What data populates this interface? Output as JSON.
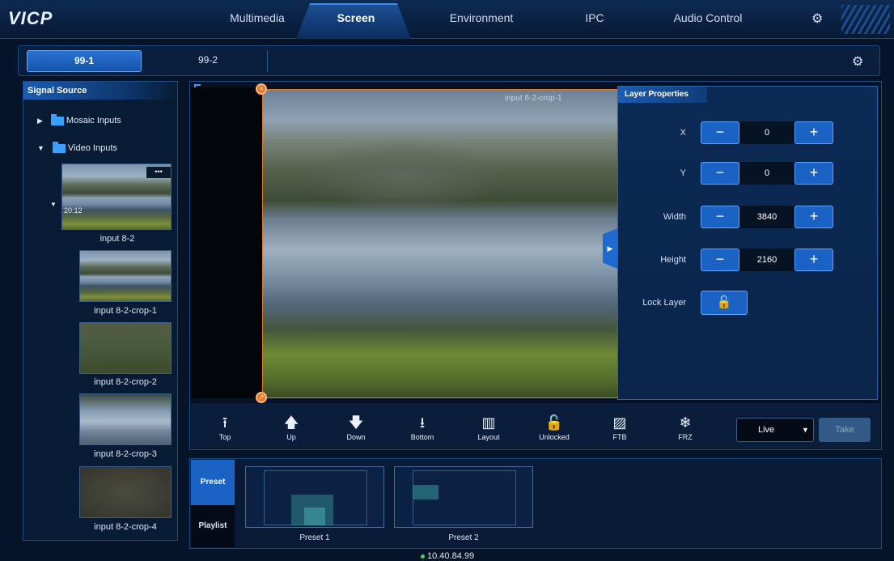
{
  "app": {
    "logo": "VICP"
  },
  "nav": {
    "tabs": [
      {
        "label": "Multimedia",
        "active": false
      },
      {
        "label": "Screen",
        "active": true
      },
      {
        "label": "Environment",
        "active": false
      },
      {
        "label": "IPC",
        "active": false
      },
      {
        "label": "Audio Control",
        "active": false
      }
    ],
    "settings_icon": "gear-icon"
  },
  "screens": {
    "tabs": [
      {
        "label": "99-1",
        "active": true
      },
      {
        "label": "99-2",
        "active": false
      }
    ],
    "settings_icon": "gear-icon"
  },
  "signal_source": {
    "title": "Signal Source",
    "groups": [
      {
        "label": "Mosaic Inputs",
        "expanded": false
      },
      {
        "label": "Video Inputs",
        "expanded": true
      }
    ],
    "inputs": [
      {
        "label": "input 8-2",
        "overlay_time": "20:12",
        "more": "•••"
      },
      {
        "label": "input 8-2-crop-1"
      },
      {
        "label": "input 8-2-crop-2"
      },
      {
        "label": "input 8-2-crop-3"
      },
      {
        "label": "input 8-2-crop-4"
      }
    ]
  },
  "canvas": {
    "layer_label": "input 8-2-crop-1"
  },
  "layer_properties": {
    "title": "Layer Properties",
    "fields": [
      {
        "label": "X",
        "value": "0"
      },
      {
        "label": "Y",
        "value": "0"
      },
      {
        "label": "Width",
        "value": "3840"
      },
      {
        "label": "Height",
        "value": "2160"
      }
    ],
    "minus": "−",
    "plus": "+",
    "lock_label": "Lock Layer",
    "lock_state": "unlocked"
  },
  "toolbar": {
    "tools": [
      {
        "label": "Top",
        "icon": "bring-to-top-icon",
        "glyph": "⭱"
      },
      {
        "label": "Up",
        "icon": "arrow-up-icon",
        "glyph": "🡅"
      },
      {
        "label": "Down",
        "icon": "arrow-down-icon",
        "glyph": "🡇"
      },
      {
        "label": "Bottom",
        "icon": "send-to-bottom-icon",
        "glyph": "⭳"
      },
      {
        "label": "Layout",
        "icon": "layout-icon",
        "glyph": "▥"
      },
      {
        "label": "Unlocked",
        "icon": "unlock-icon",
        "glyph": "🔓"
      },
      {
        "label": "FTB",
        "icon": "fade-to-black-icon",
        "glyph": "▨"
      },
      {
        "label": "FRZ",
        "icon": "freeze-icon",
        "glyph": "❄"
      }
    ],
    "mode_select": "Live",
    "take_label": "Take"
  },
  "presets": {
    "tabs": [
      {
        "label": "Preset",
        "active": true
      },
      {
        "label": "Playlist",
        "active": false
      }
    ],
    "items": [
      {
        "label": "Preset 1"
      },
      {
        "label": "Preset 2"
      }
    ]
  },
  "status": {
    "ip": "10.40.84.99",
    "status_color": "#36d66a"
  },
  "colors": {
    "accent": "#1a62c4",
    "selection_border": "#e47b27",
    "background": "#06142a"
  }
}
